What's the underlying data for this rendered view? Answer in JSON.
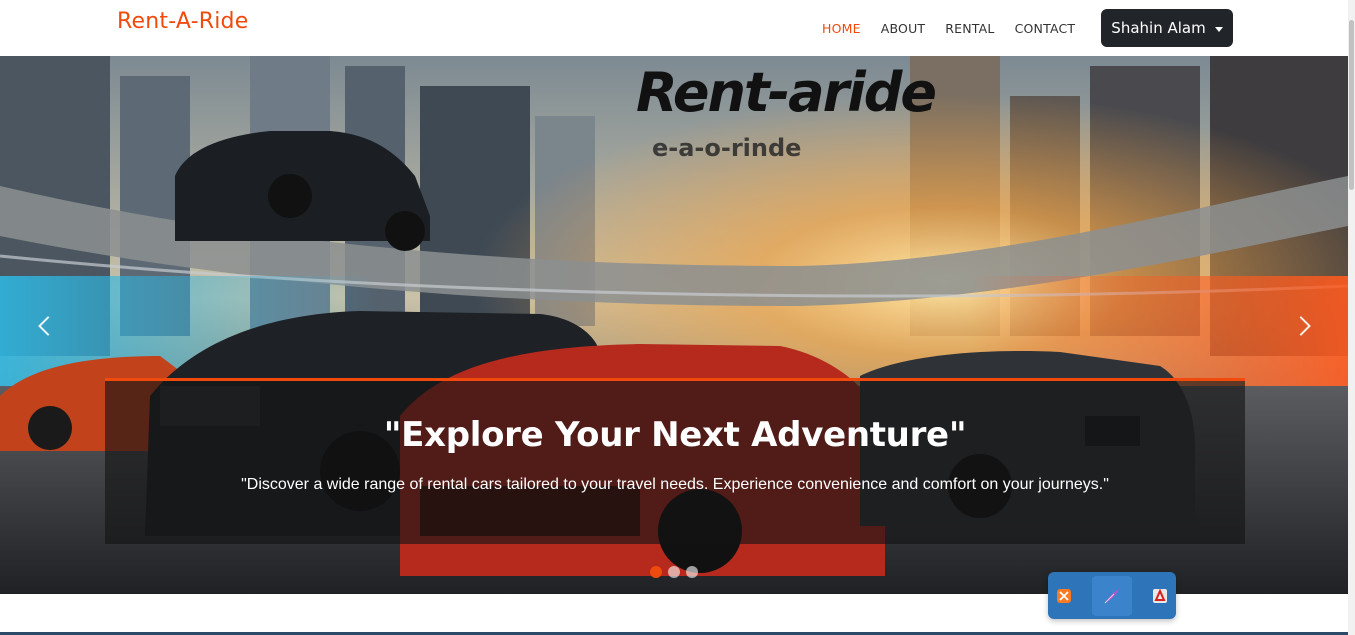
{
  "navbar": {
    "brand": "Rent-A-Ride",
    "links": [
      "HOME",
      "ABOUT",
      "RENTAL",
      "CONTACT"
    ],
    "active": "HOME",
    "user_name": "Shahin Alam"
  },
  "hero": {
    "image_logo_text": "Rent-aride",
    "image_logo_subtext": "e-a-o-rinde",
    "caption_title": "\"Explore Your Next Adventure\"",
    "caption_text": "\"Discover a wide range of rental cars tailored to your travel needs. Experience convenience and comfort on your journeys.\"",
    "slide_count": 3,
    "active_slide": 1
  },
  "widget": {
    "icons": [
      "xampp-icon",
      "feather-icon",
      "filezilla-icon"
    ]
  },
  "colors": {
    "accent": "#f04a0c",
    "dark": "#212529",
    "widget": "#2e74b9"
  }
}
